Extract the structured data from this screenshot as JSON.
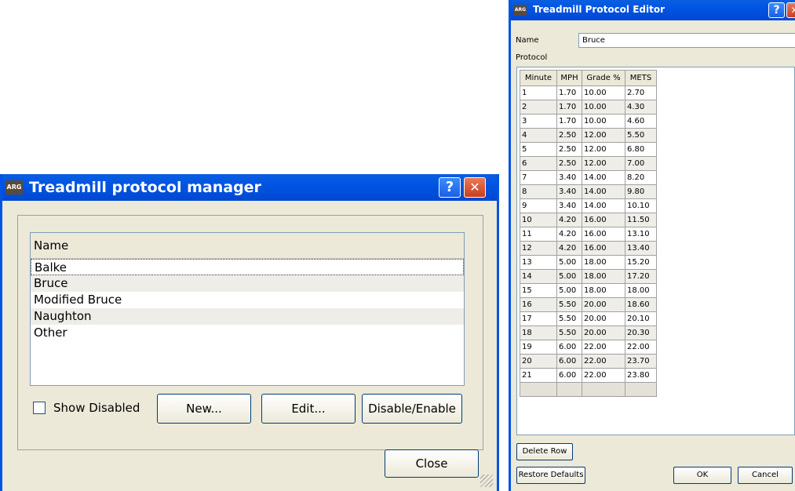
{
  "manager": {
    "title": "Treadmill protocol manager",
    "icon_label": "ARG",
    "help_glyph": "?",
    "close_glyph": "✕",
    "list_header": "Name",
    "items": [
      "Balke",
      "Bruce",
      "Modified Bruce",
      "Naughton",
      "Other"
    ],
    "show_disabled_label": "Show Disabled",
    "show_disabled_checked": false,
    "new_label": "New...",
    "edit_label": "Edit...",
    "disable_enable_label": "Disable/Enable",
    "close_label": "Close"
  },
  "editor": {
    "title": "Treadmill Protocol Editor",
    "icon_label": "ARG",
    "help_glyph": "?",
    "close_glyph": "✕",
    "name_label": "Name",
    "name_value": "Bruce",
    "protocol_label": "Protocol",
    "columns": [
      "Minute",
      "MPH",
      "Grade %",
      "METS"
    ],
    "rows": [
      [
        "1",
        "1.70",
        "10.00",
        "2.70"
      ],
      [
        "2",
        "1.70",
        "10.00",
        "4.30"
      ],
      [
        "3",
        "1.70",
        "10.00",
        "4.60"
      ],
      [
        "4",
        "2.50",
        "12.00",
        "5.50"
      ],
      [
        "5",
        "2.50",
        "12.00",
        "6.80"
      ],
      [
        "6",
        "2.50",
        "12.00",
        "7.00"
      ],
      [
        "7",
        "3.40",
        "14.00",
        "8.20"
      ],
      [
        "8",
        "3.40",
        "14.00",
        "9.80"
      ],
      [
        "9",
        "3.40",
        "14.00",
        "10.10"
      ],
      [
        "10",
        "4.20",
        "16.00",
        "11.50"
      ],
      [
        "11",
        "4.20",
        "16.00",
        "13.10"
      ],
      [
        "12",
        "4.20",
        "16.00",
        "13.40"
      ],
      [
        "13",
        "5.00",
        "18.00",
        "15.20"
      ],
      [
        "14",
        "5.00",
        "18.00",
        "17.20"
      ],
      [
        "15",
        "5.00",
        "18.00",
        "18.00"
      ],
      [
        "16",
        "5.50",
        "20.00",
        "18.60"
      ],
      [
        "17",
        "5.50",
        "20.00",
        "20.10"
      ],
      [
        "18",
        "5.50",
        "20.00",
        "20.30"
      ],
      [
        "19",
        "6.00",
        "22.00",
        "22.00"
      ],
      [
        "20",
        "6.00",
        "22.00",
        "23.70"
      ],
      [
        "21",
        "6.00",
        "22.00",
        "23.80"
      ]
    ],
    "delete_row_label": "Delete Row",
    "restore_defaults_label": "Restore Defaults",
    "ok_label": "OK",
    "cancel_label": "Cancel"
  },
  "colors": {
    "titlebar": "#0054e3",
    "window_bg": "#ece9d8",
    "alt_row": "#eeede8"
  }
}
